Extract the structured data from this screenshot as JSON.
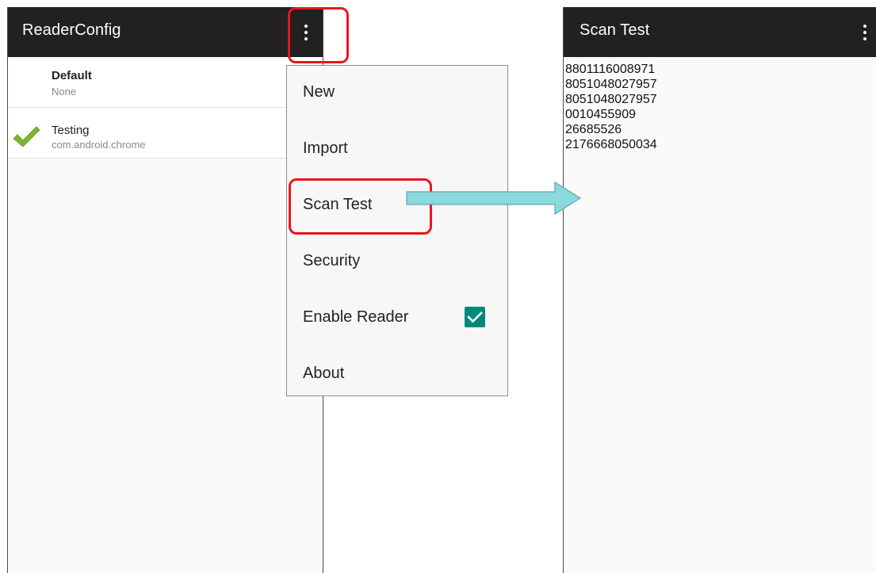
{
  "reader_config": {
    "title": "ReaderConfig",
    "profiles": [
      {
        "name": "Default",
        "subtitle": "None",
        "active": false
      },
      {
        "name": "Testing",
        "subtitle": "com.android.chrome",
        "active": true
      }
    ]
  },
  "overflow_menu": {
    "items": [
      {
        "label": "New"
      },
      {
        "label": "Import"
      },
      {
        "label": "Scan Test"
      },
      {
        "label": "Security"
      },
      {
        "label": "Enable Reader",
        "checked": true
      },
      {
        "label": "About"
      }
    ]
  },
  "scan_test": {
    "title": "Scan Test",
    "results": [
      "8801116008971",
      "8051048027957",
      "8051048027957",
      "0010455909",
      "26685526",
      "2176668050034"
    ]
  },
  "colors": {
    "appbar": "#212121",
    "highlight": "#e8161c",
    "arrow_fill": "#8ad9dc",
    "arrow_stroke": "#6a9fc0",
    "checkbox": "#00897b",
    "check_mark": "#7cb82f"
  },
  "icons": {
    "overflow": "vertical-ellipsis",
    "active_profile": "check-mark",
    "flow": "right-arrow"
  }
}
